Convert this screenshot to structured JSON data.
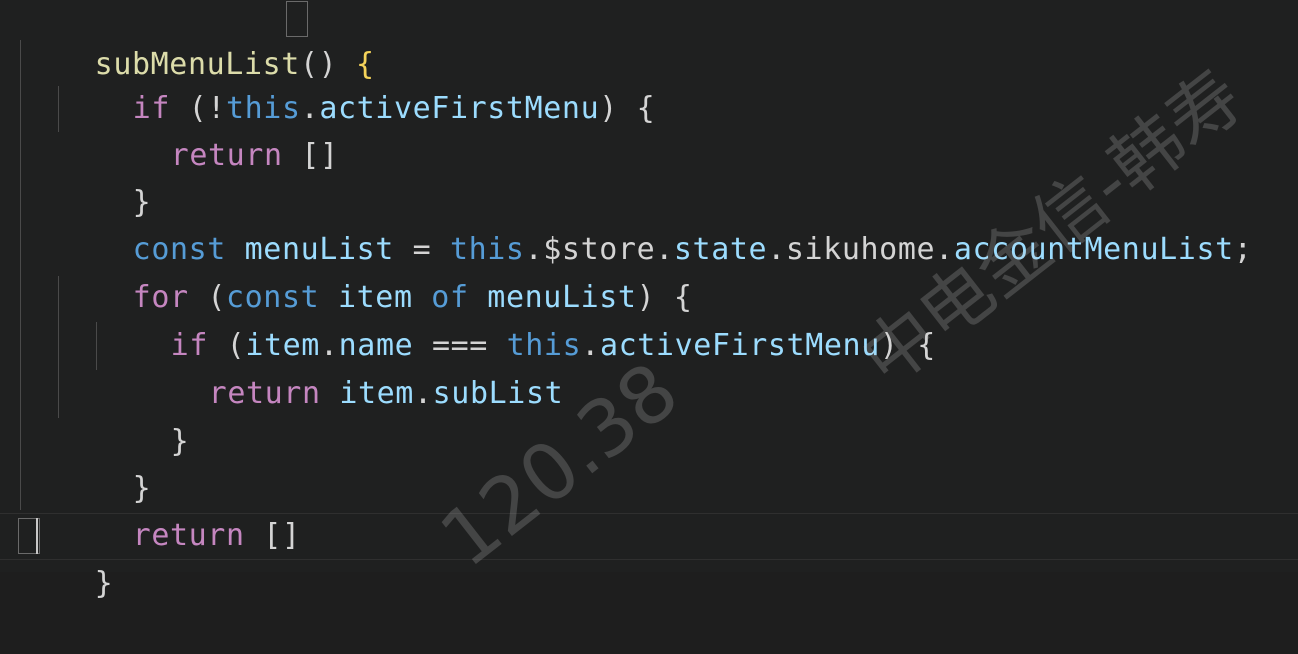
{
  "editor": {
    "lines": [
      {
        "t1": "subMenuList",
        "t2": "() ",
        "t3": "{"
      },
      {
        "kw": "if",
        "p1": " (!",
        "kw2": "this",
        "p2": ".",
        "prop": "activeFirstMenu",
        "p3": ") {"
      },
      {
        "kw": "return",
        "p1": " []"
      },
      {
        "p1": "}"
      },
      {
        "kw": "const",
        "p1": " ",
        "var": "menuList",
        "p2": " = ",
        "kw2": "this",
        "p3": ".$store.",
        "prop": "state",
        "p4": ".",
        "prop2": "sikuhome",
        "p5": ".",
        "prop3": "accountMenuList",
        "p6": ";"
      },
      {
        "kw": "for",
        "p1": " (",
        "kw2": "const",
        "p2": " ",
        "var": "item",
        "p3": " ",
        "kw3": "of",
        "p4": " ",
        "var2": "menuList",
        "p5": ") {"
      },
      {
        "kw": "if",
        "p1": " (",
        "var": "item",
        "p2": ".",
        "prop": "name",
        "p3": " === ",
        "kw2": "this",
        "p4": ".",
        "prop2": "activeFirstMenu",
        "p5": ") {"
      },
      {
        "kw": "return",
        "p1": " ",
        "var": "item",
        "p2": ".",
        "prop": "subList"
      },
      {
        "p1": "}"
      },
      {
        "p1": "}"
      },
      {
        "kw": "return",
        "p1": " []"
      },
      {
        "p1": "}"
      }
    ]
  },
  "watermark": {
    "text1": "中电金信-韩寿",
    "text2": "120.38"
  },
  "colors": {
    "background": "#1f2020",
    "keyword_control": "#c586c0",
    "keyword_declaration": "#569cd6",
    "function": "#dcdcaa",
    "variable": "#9cdcfe",
    "default_text": "#d4d4d4"
  }
}
